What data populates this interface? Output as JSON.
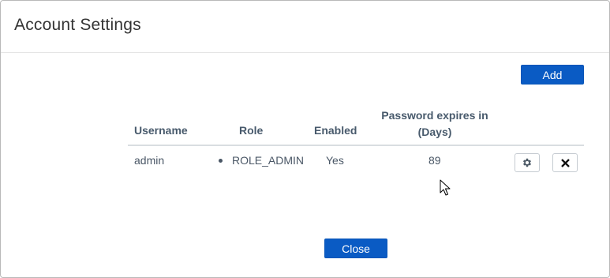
{
  "dialog": {
    "title": "Account Settings",
    "add_label": "Add",
    "close_label": "Close"
  },
  "table": {
    "headers": {
      "username": "Username",
      "role": "Role",
      "enabled": "Enabled",
      "expires": "Password expires in (Days)"
    },
    "rows": [
      {
        "username": "admin",
        "role": "ROLE_ADMIN",
        "enabled": "Yes",
        "expires": "89",
        "actions": [
          "gear-icon",
          "close-icon"
        ]
      }
    ]
  },
  "colors": {
    "primary": "#0a5bc4",
    "header_text": "#485a6c",
    "body_text": "#4a5766"
  }
}
